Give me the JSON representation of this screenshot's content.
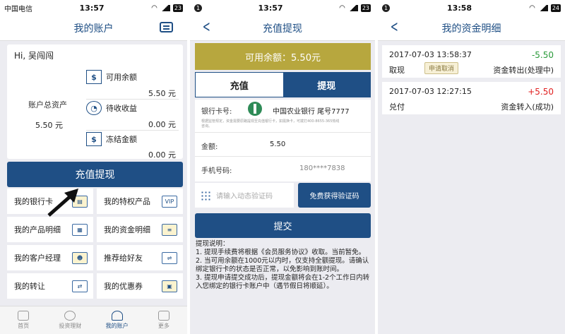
{
  "p1": {
    "status": {
      "carrier": "中国电信",
      "time": "13:57",
      "battery": "23"
    },
    "title": "我的账户",
    "greeting": "Hi, 吴闯闯",
    "total_label": "账户总资产",
    "total_value": "5.50 元",
    "balances": [
      {
        "label": "可用余额",
        "value": "5.50 元",
        "icon": "$"
      },
      {
        "label": "待收收益",
        "value": "0.00 元",
        "icon": "clock"
      },
      {
        "label": "冻结金额",
        "value": "0.00 元",
        "icon": "$"
      }
    ],
    "primary_button": "充值提现",
    "grid": [
      {
        "label": "我的银行卡",
        "icon": "card-icon"
      },
      {
        "label": "我的特权产品",
        "icon": "vip-icon",
        "badge": "VIP"
      },
      {
        "label": "我的产品明细",
        "icon": "calendar-icon"
      },
      {
        "label": "我的资金明细",
        "icon": "statement-icon"
      },
      {
        "label": "我的客户经理",
        "icon": "people-icon"
      },
      {
        "label": "推荐给好友",
        "icon": "handshake-icon"
      },
      {
        "label": "我的转让",
        "icon": "transfer-icon"
      },
      {
        "label": "我的优惠券",
        "icon": "coupon-icon"
      }
    ],
    "tabs": [
      {
        "label": "首页",
        "active": false
      },
      {
        "label": "投资理财",
        "active": false
      },
      {
        "label": "我的账户",
        "active": true
      },
      {
        "label": "更多",
        "active": false
      }
    ]
  },
  "p2": {
    "status": {
      "dot": "1",
      "time": "13:57",
      "battery": "23"
    },
    "title": "充值提现",
    "available": "可用余额：5.50元",
    "tabs": [
      "充值",
      "提现"
    ],
    "bank_label": "银行卡号:",
    "bank_value": "中国农业银行 尾号7777",
    "bank_note": "根据监管规定，资金需要原路提现至充值银行卡，如需换卡，可拨打400-8655-365热线咨询。",
    "amount_label": "金额:",
    "amount_value": "5.50",
    "phone_label": "手机号码:",
    "phone_value": "180****7838",
    "code_placeholder": "请输入动态验证码",
    "get_code": "免费获得验证码",
    "submit": "提交",
    "notes": [
      "提现说明：",
      "1. 提现手续费将根据《会员服务协议》收取。当前暂免。",
      "2. 当可用余额在1000元以内时，仅支持全额提现。请确认绑定银行卡的状态是否正常，以免影响到账时间。",
      "3. 提现申请提交成功后，提现金额将会在1-2个工作日内转入您绑定的银行卡账户中（遇节假日将顺延）。"
    ]
  },
  "p3": {
    "status": {
      "dot": "1",
      "time": "13:58",
      "battery": "24"
    },
    "title": "我的资金明细",
    "records": [
      {
        "time": "2017-07-03 13:58:37",
        "amount": "-5.50",
        "type": "取现",
        "status": "资金转出(处理中)",
        "action": "申请取消",
        "color": "#2a9a3a"
      },
      {
        "time": "2017-07-03 12:27:15",
        "amount": "+5.50",
        "type": "兑付",
        "status": "资金转入(成功)",
        "action": "",
        "color": "#e02020"
      }
    ]
  },
  "colors": {
    "brand": "#1f4f85",
    "gold": "#b7a73e",
    "bg": "#ececf1"
  }
}
